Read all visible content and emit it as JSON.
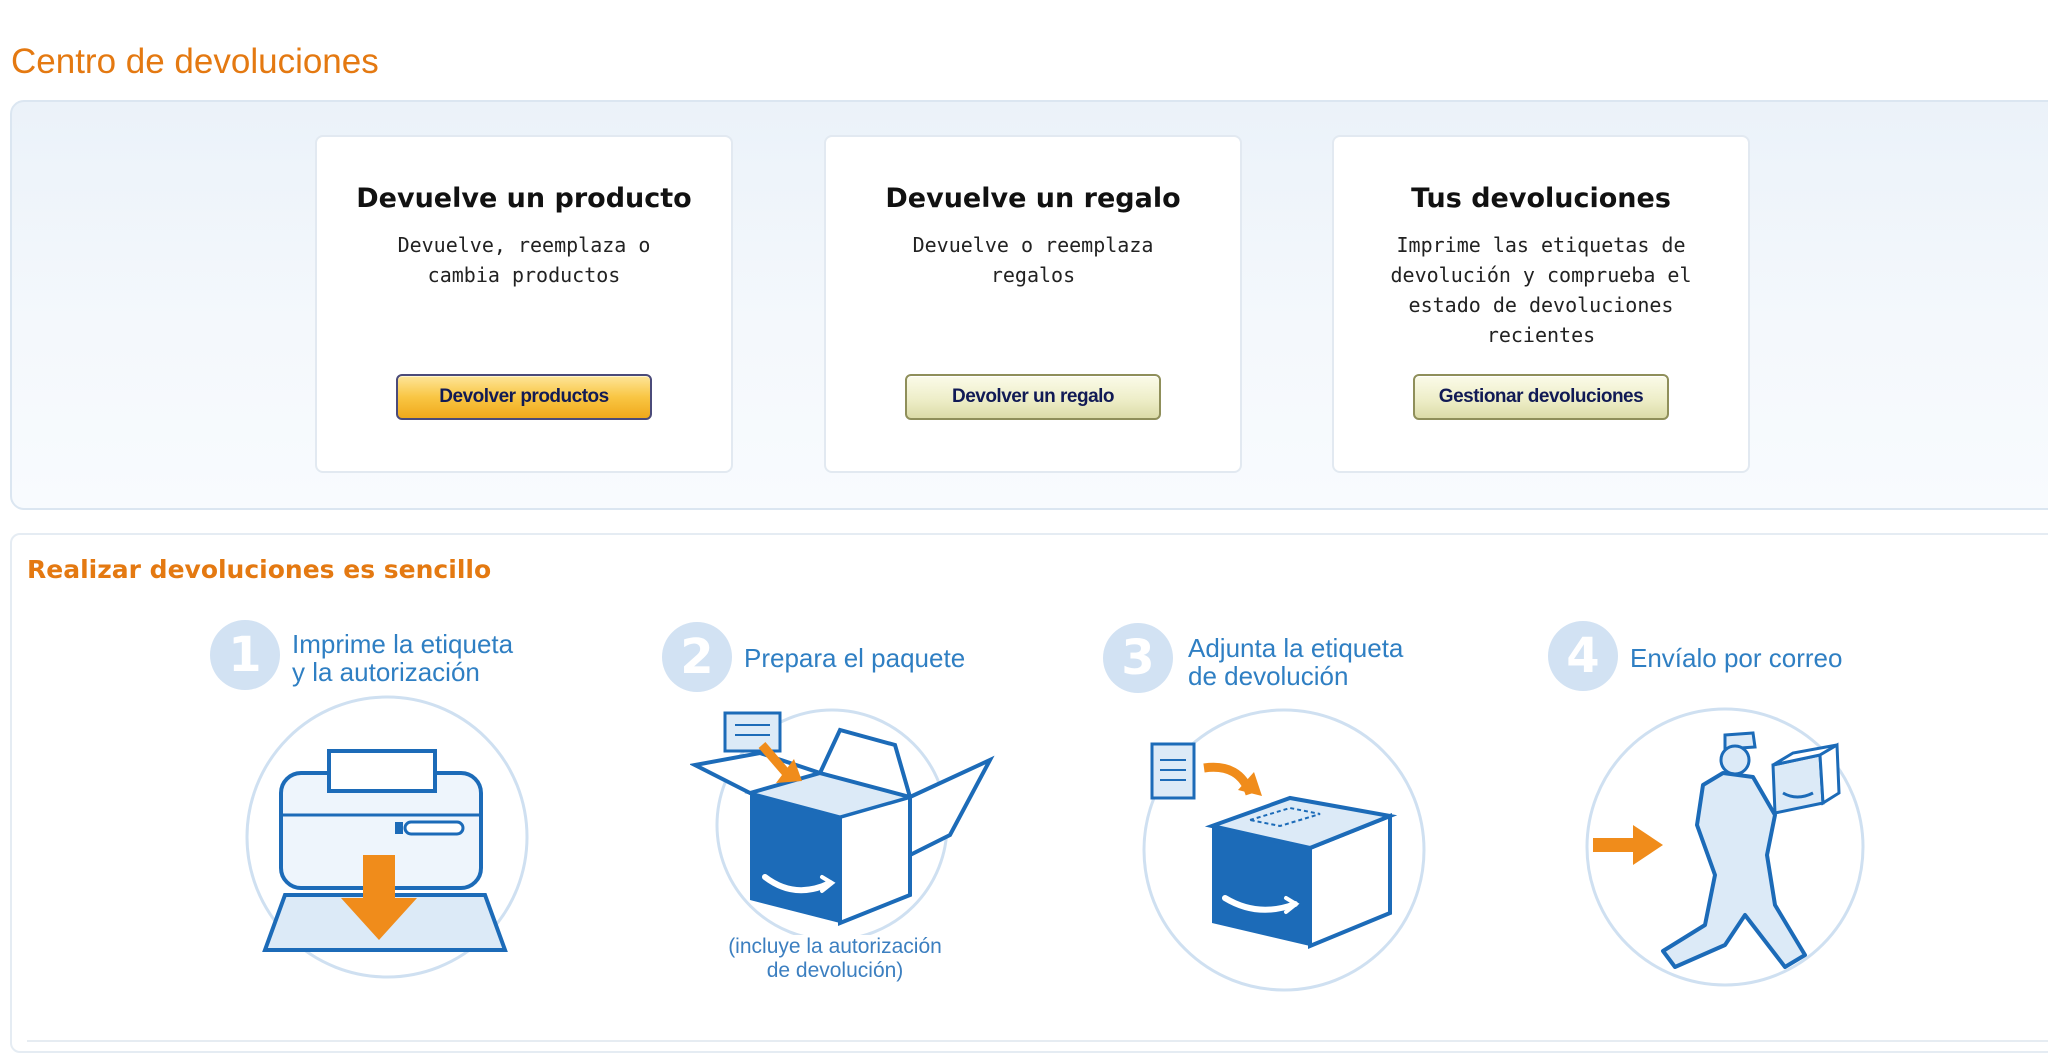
{
  "page": {
    "title": "Centro de devoluciones"
  },
  "colors": {
    "accent": "#e47911",
    "step_blue": "#2f7fc3",
    "box_blue": "#1c6bb8",
    "arrow_orange": "#f08c1b"
  },
  "cards": [
    {
      "title": "Devuelve un producto",
      "desc": "Devuelve, reemplaza o cambia productos",
      "button": "Devolver productos"
    },
    {
      "title": "Devuelve un regalo",
      "desc": "Devuelve o reemplaza regalos",
      "button": "Devolver un regalo"
    },
    {
      "title": "Tus devoluciones",
      "desc": "Imprime las etiquetas de devolución y comprueba el estado de devoluciones recientes",
      "button": "Gestionar devoluciones"
    }
  ],
  "steps_section": {
    "title": "Realizar devoluciones es sencillo",
    "steps": [
      {
        "number": "1",
        "line1": "Imprime la etiqueta",
        "line2": "y la autorización",
        "icon": "printer-icon"
      },
      {
        "number": "2",
        "line1": "Prepara el paquete",
        "line2": "",
        "icon": "open-box-icon"
      },
      {
        "number": "3",
        "line1": "Adjunta la etiqueta",
        "line2": "de devolución",
        "icon": "closed-box-icon"
      },
      {
        "number": "4",
        "line1": "Envíalo por correo",
        "line2": "",
        "icon": "courier-icon"
      }
    ],
    "note_line1": "(incluye la autorización",
    "note_line2": "de devolución)"
  }
}
